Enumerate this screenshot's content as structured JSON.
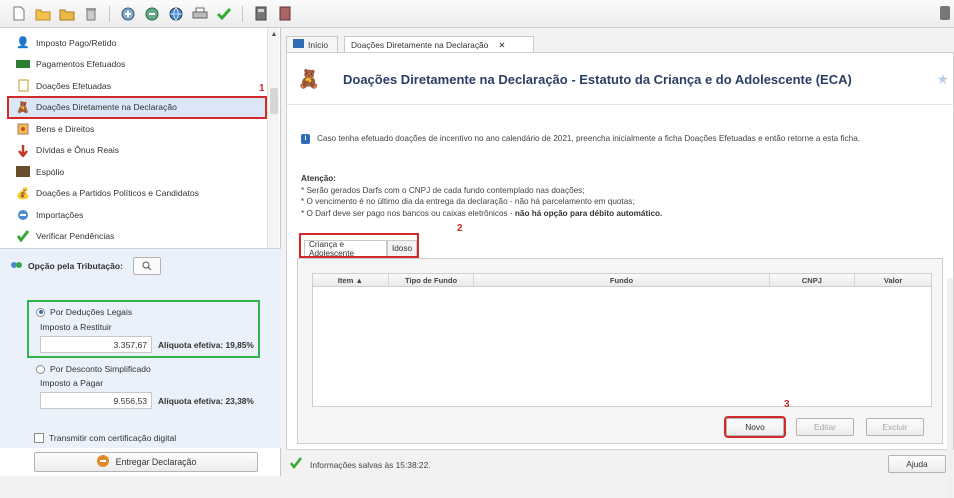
{
  "toolbar": {
    "icons": [
      "new-file-icon",
      "open-folder-icon",
      "folder-icon",
      "trash-icon",
      "import-icon",
      "export-icon",
      "globe-icon",
      "print-icon",
      "check-icon",
      "calculator-icon",
      "book-icon"
    ]
  },
  "sidebar": {
    "items": [
      {
        "label": "Imposto Pago/Retido",
        "icon": "person-money-icon"
      },
      {
        "label": "Pagamentos Efetuados",
        "icon": "cash-icon"
      },
      {
        "label": "Doações Efetuadas",
        "icon": "document-icon"
      },
      {
        "label": "Doações Diretamente na Declaração",
        "icon": "donation-icon"
      },
      {
        "label": "Bens e Direitos",
        "icon": "assets-icon"
      },
      {
        "label": "Dívidas e Ônus Reais",
        "icon": "debt-icon"
      },
      {
        "label": "Espólio",
        "icon": "estate-icon"
      },
      {
        "label": "Doações a Partidos Políticos e Candidatos",
        "icon": "party-icon"
      },
      {
        "label": "Importações",
        "icon": "import-icon"
      },
      {
        "label": "Verificar Pendências",
        "icon": "check-icon"
      }
    ],
    "markers": {
      "m1": "1",
      "m2": "2",
      "m3": "3"
    }
  },
  "tributacao": {
    "heading": "Opção pela Tributação:",
    "legais": {
      "option": "Por Deduções Legais",
      "label": "Imposto a Restituir",
      "value": "3.357,67",
      "aliquota": "Alíquota efetiva: 19,85%"
    },
    "simplificado": {
      "option": "Por Desconto Simplificado",
      "label": "Imposto a Pagar",
      "value": "9.556,53",
      "aliquota": "Alíquota efetiva: 23,38%"
    },
    "transmitir": "Transmitir com certificação digital",
    "entregar": "Entregar Declaração"
  },
  "tabs": {
    "inicio": "Início",
    "doacoes": "Doações Diretamente na Declaração"
  },
  "page": {
    "title": "Doações Diretamente na Declaração - Estatuto da Criança e do Adolescente (ECA)",
    "info": "Caso tenha efetuado doações de incentivo no ano calendário de 2021, preencha inicialmente a ficha Doações Efetuadas e então retorne a esta ficha.",
    "atencao": "Atenção:",
    "lines": [
      "* Serão gerados Darfs com o CNPJ de cada fundo contemplado nas doações;",
      "* O vencimento é no último dia da entrega da declaração - não há parcelamento em quotas;",
      "* O Darf deve ser pago nos bancos ou caixas eletrônicos - "
    ],
    "line3_bold": "não há opção para débito automático."
  },
  "subtabs": {
    "crianca": "Criança e Adolescente",
    "idoso": "Idoso"
  },
  "grid": {
    "columns": [
      "Item ▲",
      "Tipo de Fundo",
      "Fundo",
      "CNPJ",
      "Valor"
    ]
  },
  "buttons": {
    "novo": "Novo",
    "editar": "Editar",
    "excluir": "Excluir",
    "ajuda": "Ajuda"
  },
  "status": {
    "text": "Informações salvas às 15:38:22."
  }
}
